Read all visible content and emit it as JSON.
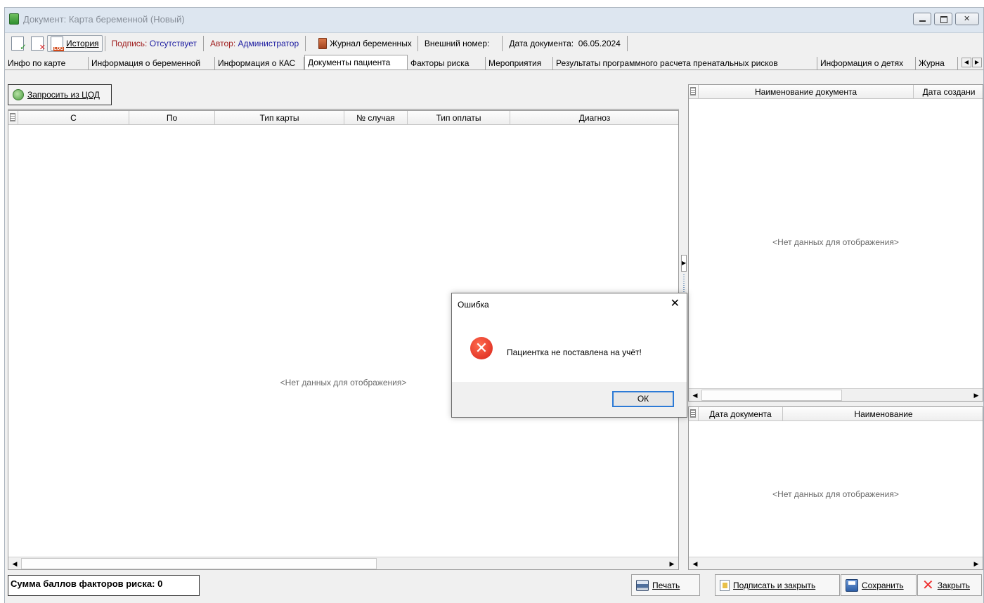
{
  "window": {
    "title": "Документ: Карта беременной (Новый)"
  },
  "toolbar": {
    "history_label": "История",
    "signature_label": "Подпись:",
    "signature_value": "Отсутствует",
    "author_label": "Автор:",
    "author_value": "Администратор",
    "journal_label": "Журнал беременных",
    "external_number_label": "Внешний номер:",
    "doc_date_label": "Дата документа:",
    "doc_date_value": "06.05.2024"
  },
  "tabs": [
    {
      "label": "Инфо по карте"
    },
    {
      "label": "Информация о беременной"
    },
    {
      "label": "Информация о КАС"
    },
    {
      "label": "Документы пациента",
      "active": true
    },
    {
      "label": "Факторы риска"
    },
    {
      "label": "Мероприятия"
    },
    {
      "label": "Результаты программного расчета пренатальных рисков"
    },
    {
      "label": "Информация о детях"
    },
    {
      "label": "Журна"
    }
  ],
  "left_panel": {
    "request_button": "Запросить из ЦОД",
    "columns": [
      "С",
      "По",
      "Тип карты",
      "№ случая",
      "Тип оплаты",
      "Диагноз"
    ],
    "empty_text": "<Нет данных для отображения>"
  },
  "right_top": {
    "columns": [
      "Наименование документа",
      "Дата создани"
    ],
    "empty_text": "<Нет данных для отображения>"
  },
  "right_bottom": {
    "columns": [
      "Дата документа",
      "Наименование"
    ],
    "empty_text": "<Нет данных для отображения>"
  },
  "footer": {
    "risk_sum": "Сумма баллов факторов риска: 0",
    "print_label": "Печать",
    "sign_close_label": "Подписать и закрыть",
    "save_label": "Сохранить",
    "close_label": "Закрыть"
  },
  "dialog": {
    "title": "Ошибка",
    "message": "Пациентка не поставлена на учёт!",
    "ok_label": "ОК"
  },
  "colors": {
    "signature_label": "#a02020",
    "signature_value": "#1a1aa0",
    "author_label": "#a02020",
    "author_value": "#1a1aa0",
    "focus_border": "#2c7ad6",
    "error_icon": "#d8231a"
  }
}
